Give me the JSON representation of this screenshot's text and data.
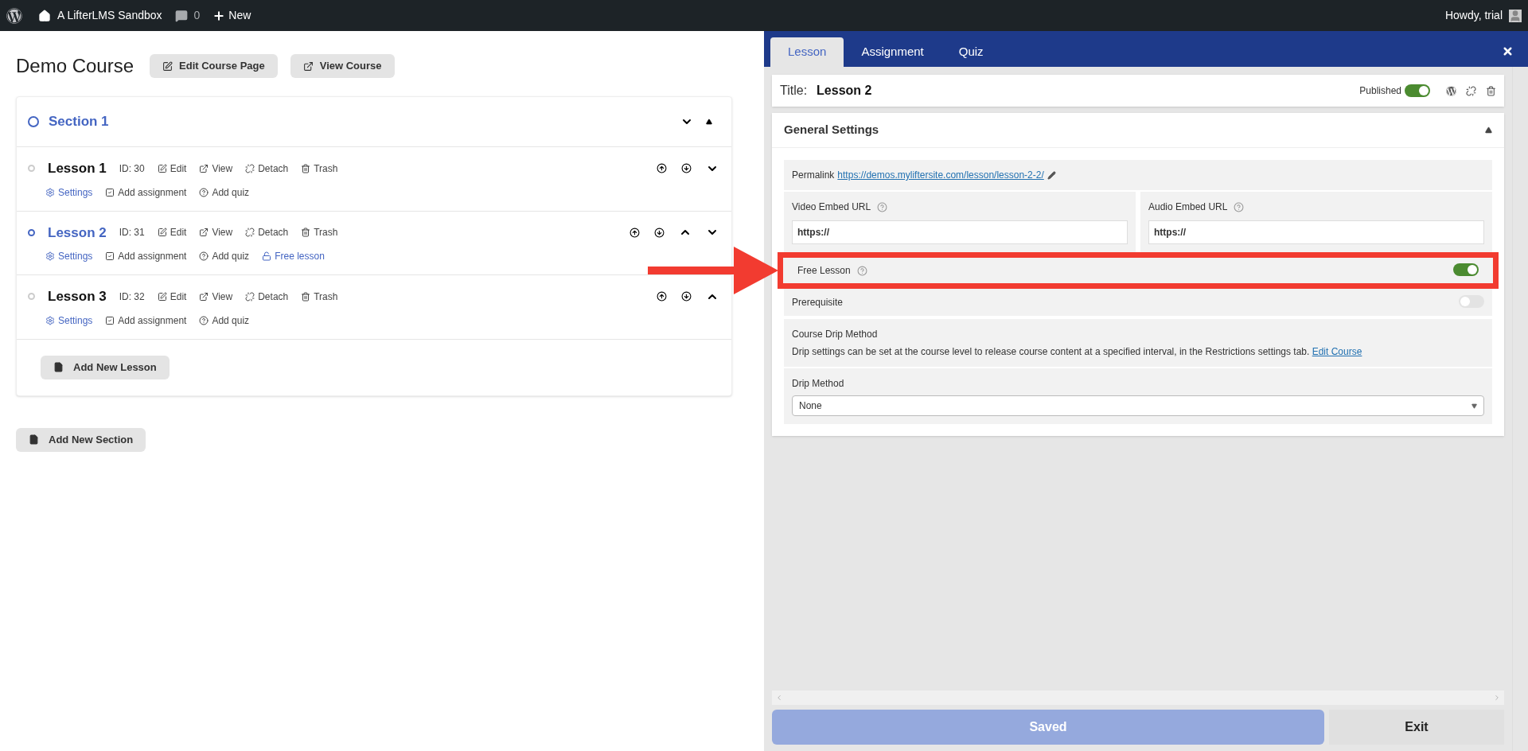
{
  "admin_bar": {
    "site": "A LifterLMS Sandbox",
    "comments": "0",
    "new": "New",
    "greeting": "Howdy, trial"
  },
  "course": {
    "title": "Demo Course",
    "buttons": [
      {
        "kind": "edit",
        "label": "Edit Course Page"
      },
      {
        "kind": "view",
        "label": "View Course"
      }
    ]
  },
  "section": {
    "title": "Section 1"
  },
  "lessons": [
    {
      "title": "Lesson 1",
      "id": "ID: 30",
      "selected": false,
      "move_up": false,
      "move_down": true,
      "actions": [
        {
          "kind": "edit",
          "label": "Edit"
        },
        {
          "kind": "view",
          "label": "View"
        },
        {
          "kind": "detach",
          "label": "Detach"
        },
        {
          "kind": "trash",
          "label": "Trash"
        }
      ],
      "links": [
        {
          "kind": "settings",
          "label": "Settings"
        },
        {
          "kind": "assignment",
          "label": "Add assignment"
        },
        {
          "kind": "quiz",
          "label": "Add quiz"
        }
      ]
    },
    {
      "title": "Lesson 2",
      "id": "ID: 31",
      "selected": true,
      "move_up": true,
      "move_down": true,
      "actions": [
        {
          "kind": "edit",
          "label": "Edit"
        },
        {
          "kind": "view",
          "label": "View"
        },
        {
          "kind": "detach",
          "label": "Detach"
        },
        {
          "kind": "trash",
          "label": "Trash"
        }
      ],
      "links": [
        {
          "kind": "settings",
          "label": "Settings"
        },
        {
          "kind": "assignment",
          "label": "Add assignment"
        },
        {
          "kind": "quiz",
          "label": "Add quiz"
        },
        {
          "kind": "free",
          "label": "Free lesson"
        }
      ]
    },
    {
      "title": "Lesson 3",
      "id": "ID: 32",
      "selected": false,
      "move_up": true,
      "move_down": false,
      "actions": [
        {
          "kind": "edit",
          "label": "Edit"
        },
        {
          "kind": "view",
          "label": "View"
        },
        {
          "kind": "detach",
          "label": "Detach"
        },
        {
          "kind": "trash",
          "label": "Trash"
        }
      ],
      "links": [
        {
          "kind": "settings",
          "label": "Settings"
        },
        {
          "kind": "assignment",
          "label": "Add assignment"
        },
        {
          "kind": "quiz",
          "label": "Add quiz"
        }
      ]
    }
  ],
  "add_lesson": "Add New Lesson",
  "add_section": "Add New Section",
  "panel": {
    "tabs": [
      {
        "label": "Lesson",
        "selected": true
      },
      {
        "label": "Assignment",
        "selected": false
      },
      {
        "label": "Quiz",
        "selected": false
      }
    ],
    "title_label": "Title:",
    "title_value": "Lesson 2",
    "published": {
      "label": "Published",
      "on": true
    },
    "settings": {
      "heading": "General Settings",
      "expanded": true,
      "permalink": {
        "label": "Permalink",
        "url": "https://demos.myliftersite.com/lesson/lesson-2-2/"
      },
      "video": {
        "label": "Video Embed URL",
        "value": "https://"
      },
      "audio": {
        "label": "Audio Embed URL",
        "value": "https://"
      },
      "free_lesson": {
        "label": "Free Lesson",
        "on": true,
        "highlighted": true
      },
      "prerequisite": {
        "label": "Prerequisite",
        "on": false
      },
      "drip": {
        "heading": "Course Drip Method",
        "description": "Drip settings can be set at the course level to release course content at a specified interval, in the Restrictions settings tab.",
        "link": "Edit Course"
      },
      "drip_method": {
        "label": "Drip Method",
        "value": "None"
      }
    },
    "save": "Saved",
    "exit": "Exit"
  }
}
